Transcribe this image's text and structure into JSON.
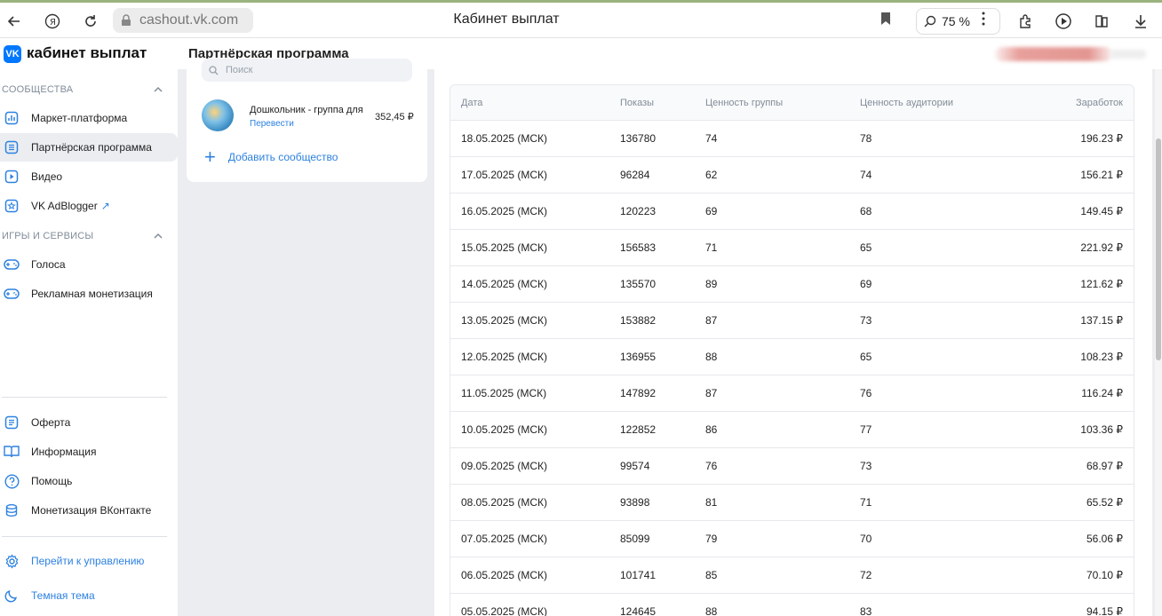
{
  "browser": {
    "url": "cashout.vk.com",
    "title": "Кабинет выплат",
    "zoom": "75 %"
  },
  "header": {
    "brand": "кабинет выплат",
    "section": "Партнёрская программа"
  },
  "sidebar": {
    "cat1": "Сообщества",
    "cat2": "Игры и сервисы",
    "items": [
      {
        "label": "Маркет-платформа"
      },
      {
        "label": "Партнёрская программа"
      },
      {
        "label": "Видео"
      },
      {
        "label": "VK AdBlogger"
      },
      {
        "label": "Голоса"
      },
      {
        "label": "Рекламная монетизация"
      },
      {
        "label": "Оферта"
      },
      {
        "label": "Информация"
      },
      {
        "label": "Помощь"
      },
      {
        "label": "Монетизация ВКонтакте"
      },
      {
        "label": "Перейти к управлению"
      },
      {
        "label": "Темная тема"
      }
    ]
  },
  "community": {
    "search_placeholder": "Поиск",
    "name": "Дошкольник - группа для",
    "translate": "Перевести",
    "amount": "352,45 ₽",
    "add": "Добавить сообщество"
  },
  "table": {
    "headers": {
      "date": "Дата",
      "views": "Показы",
      "group_value": "Ценность группы",
      "audience_value": "Ценность аудитории",
      "earnings": "Заработок"
    },
    "rows": [
      {
        "date": "18.05.2025 (МСК)",
        "views": "136780",
        "gv": "74",
        "av": "78",
        "earn": "196.23 ₽"
      },
      {
        "date": "17.05.2025 (МСК)",
        "views": "96284",
        "gv": "62",
        "av": "74",
        "earn": "156.21 ₽"
      },
      {
        "date": "16.05.2025 (МСК)",
        "views": "120223",
        "gv": "69",
        "av": "68",
        "earn": "149.45 ₽"
      },
      {
        "date": "15.05.2025 (МСК)",
        "views": "156583",
        "gv": "71",
        "av": "65",
        "earn": "221.92 ₽"
      },
      {
        "date": "14.05.2025 (МСК)",
        "views": "135570",
        "gv": "89",
        "av": "69",
        "earn": "121.62 ₽"
      },
      {
        "date": "13.05.2025 (МСК)",
        "views": "153882",
        "gv": "87",
        "av": "73",
        "earn": "137.15 ₽"
      },
      {
        "date": "12.05.2025 (МСК)",
        "views": "136955",
        "gv": "88",
        "av": "65",
        "earn": "108.23 ₽"
      },
      {
        "date": "11.05.2025 (МСК)",
        "views": "147892",
        "gv": "87",
        "av": "76",
        "earn": "116.24 ₽"
      },
      {
        "date": "10.05.2025 (МСК)",
        "views": "122852",
        "gv": "86",
        "av": "77",
        "earn": "103.36 ₽"
      },
      {
        "date": "09.05.2025 (МСК)",
        "views": "99574",
        "gv": "76",
        "av": "73",
        "earn": "68.97 ₽"
      },
      {
        "date": "08.05.2025 (МСК)",
        "views": "93898",
        "gv": "81",
        "av": "71",
        "earn": "65.52 ₽"
      },
      {
        "date": "07.05.2025 (МСК)",
        "views": "85099",
        "gv": "79",
        "av": "70",
        "earn": "56.06 ₽"
      },
      {
        "date": "06.05.2025 (МСК)",
        "views": "101741",
        "gv": "85",
        "av": "72",
        "earn": "70.10 ₽"
      },
      {
        "date": "05.05.2025 (МСК)",
        "views": "124645",
        "gv": "88",
        "av": "83",
        "earn": "94.15 ₽"
      }
    ]
  }
}
